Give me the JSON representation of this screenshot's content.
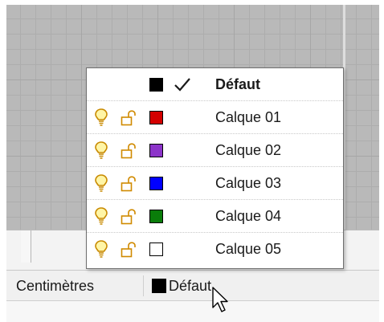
{
  "statusbar": {
    "units_label": "Centimètres",
    "current_layer_label": "Défaut",
    "current_layer_color": "#000000"
  },
  "layer_popup": {
    "rows": [
      {
        "label": "Défaut",
        "color": "#000000",
        "current": true,
        "icons": [
          "swatch",
          "checkmark-icon"
        ]
      },
      {
        "label": "Calque 01",
        "color": "#d40000",
        "current": false,
        "icons": [
          "lightbulb-icon",
          "unlock-icon",
          "swatch"
        ]
      },
      {
        "label": "Calque 02",
        "color": "#8c34c9",
        "current": false,
        "icons": [
          "lightbulb-icon",
          "unlock-icon",
          "swatch"
        ]
      },
      {
        "label": "Calque 03",
        "color": "#0000ff",
        "current": false,
        "icons": [
          "lightbulb-icon",
          "unlock-icon",
          "swatch"
        ]
      },
      {
        "label": "Calque 04",
        "color": "#0a7d0a",
        "current": false,
        "icons": [
          "lightbulb-icon",
          "unlock-icon",
          "swatch"
        ]
      },
      {
        "label": "Calque 05",
        "color": "#ffffff",
        "current": false,
        "icons": [
          "lightbulb-icon",
          "unlock-icon",
          "swatch"
        ]
      }
    ]
  },
  "colors": {
    "viewport_bg": "#b9b9b9",
    "bulb_fill": "#fff5a6",
    "bulb_stroke": "#c88a00",
    "lock_stroke": "#d08a00"
  }
}
